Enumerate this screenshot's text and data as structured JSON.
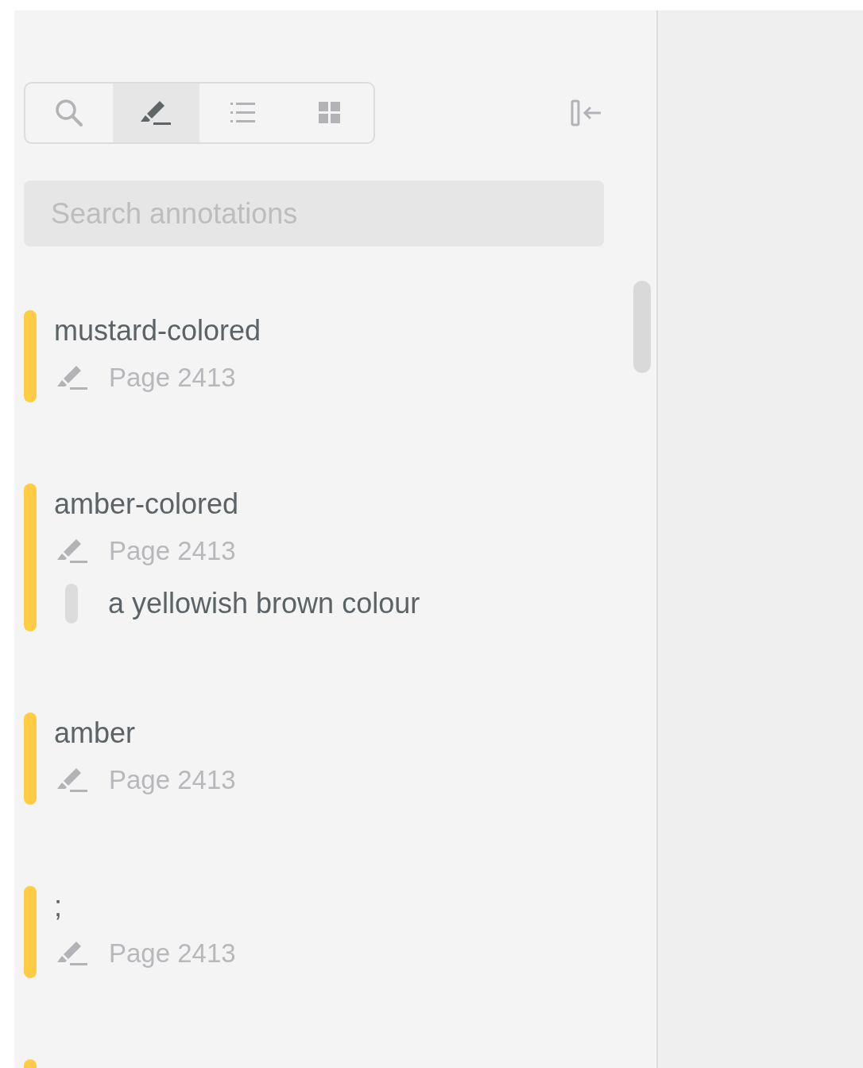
{
  "toolbar": {
    "modes": [
      {
        "kind": "search",
        "selected": false
      },
      {
        "kind": "highlight",
        "selected": true
      },
      {
        "kind": "outline",
        "selected": false
      },
      {
        "kind": "thumbnails",
        "selected": false
      }
    ]
  },
  "search": {
    "placeholder": "Search annotations"
  },
  "annotations": [
    {
      "title": "mustard-colored",
      "page": "Page 2413",
      "color": "#ffcc44"
    },
    {
      "title": "amber-colored",
      "page": "Page 2413",
      "note": "a yellowish brown colour",
      "color": "#ffcc44"
    },
    {
      "title": "amber",
      "page": "Page 2413",
      "color": "#ffcc44"
    },
    {
      "title": ";",
      "page": "Page 2413",
      "color": "#ffcc44"
    },
    {
      "color": "#ffcc44"
    }
  ]
}
